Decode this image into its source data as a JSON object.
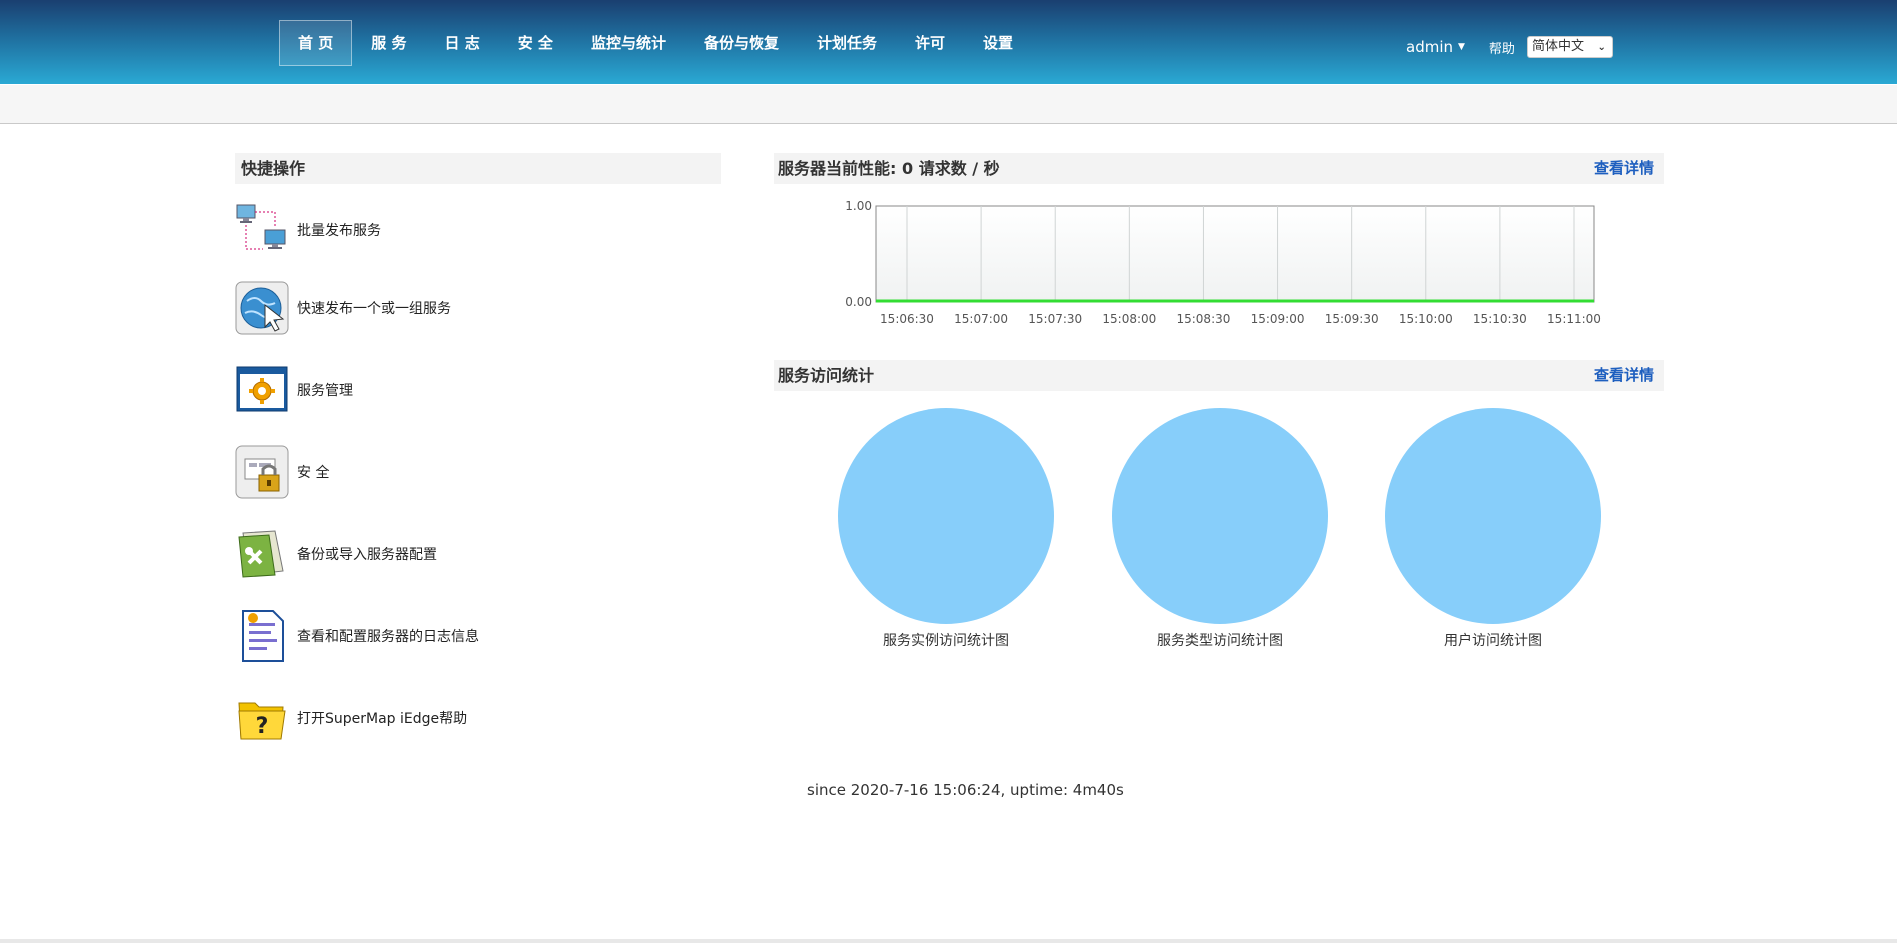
{
  "nav": {
    "items": [
      {
        "label": "首 页",
        "active": true
      },
      {
        "label": "服 务"
      },
      {
        "label": "日 志"
      },
      {
        "label": "安 全"
      },
      {
        "label": "监控与统计"
      },
      {
        "label": "备份与恢复"
      },
      {
        "label": "计划任务"
      },
      {
        "label": "许可"
      },
      {
        "label": "设置"
      }
    ],
    "user": "admin",
    "help": "帮助",
    "language": "简体中文"
  },
  "quick": {
    "title": "快捷操作",
    "items": [
      {
        "label": "批量发布服务",
        "icon": "batch-publish-icon"
      },
      {
        "label": "快速发布一个或一组服务",
        "icon": "quick-publish-icon"
      },
      {
        "label": "服务管理",
        "icon": "service-manage-icon"
      },
      {
        "label": "安 全",
        "icon": "security-lock-icon"
      },
      {
        "label": "备份或导入服务器配置",
        "icon": "backup-icon"
      },
      {
        "label": "查看和配置服务器的日志信息",
        "icon": "log-icon"
      },
      {
        "label": "打开SuperMap iEdge帮助",
        "icon": "help-folder-icon"
      }
    ]
  },
  "performance": {
    "title": "服务器当前性能: ",
    "value_text": "0 请求数 / 秒",
    "detail": "查看详情"
  },
  "chart_data": {
    "type": "line",
    "x": [
      "15:06:30",
      "15:07:00",
      "15:07:30",
      "15:08:00",
      "15:08:30",
      "15:09:00",
      "15:09:30",
      "15:10:00",
      "15:10:30",
      "15:11:00"
    ],
    "series": [
      {
        "values": [
          0,
          0,
          0,
          0,
          0,
          0,
          0,
          0,
          0,
          0
        ],
        "color": "#33dd33"
      }
    ],
    "yticks": [
      "1.00",
      "0.00"
    ],
    "ylim": [
      0,
      1
    ],
    "grid": true
  },
  "stats": {
    "title": "服务访问统计",
    "detail": "查看详情",
    "pies": [
      {
        "label": "服务实例访问统计图"
      },
      {
        "label": "服务类型访问统计图"
      },
      {
        "label": "用户访问统计图"
      }
    ],
    "pie_color": "#87cefa"
  },
  "footer": {
    "text": "since 2020-7-16 15:06:24, uptime: 4m40s"
  }
}
